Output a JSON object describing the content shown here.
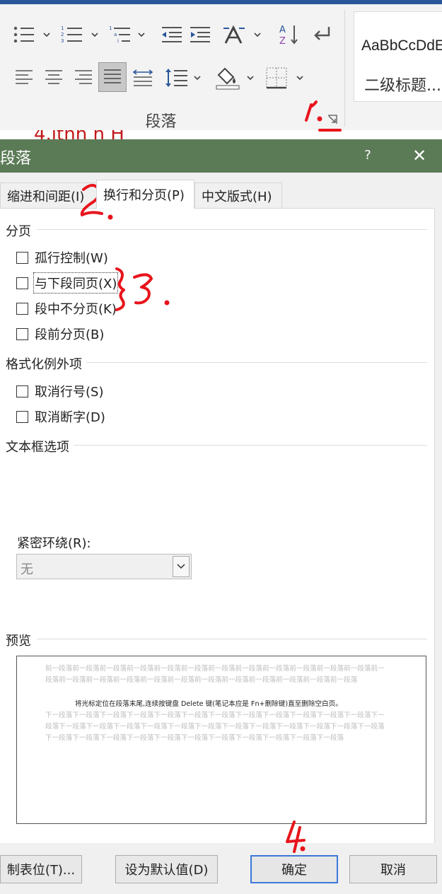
{
  "ribbon": {
    "group_label": "段落",
    "styles": [
      "AaBbCcDdE",
      "二级标题..."
    ]
  },
  "document": {
    "behind_text": "4.itnh h H"
  },
  "dialog": {
    "title": "段落",
    "help_label": "?",
    "close_label": "✕",
    "tabs": [
      "缩进和间距(I)",
      "换行和分页(P)",
      "中文版式(H)"
    ],
    "pagination": {
      "heading": "分页",
      "options": [
        {
          "label": "孤行控制(W)",
          "checked": false
        },
        {
          "label": "与下段同页(X)",
          "checked": false
        },
        {
          "label": "段中不分页(K)",
          "checked": false
        },
        {
          "label": "段前分页(B)",
          "checked": false
        }
      ]
    },
    "formatting_exceptions": {
      "heading": "格式化例外项",
      "options": [
        {
          "label": "取消行号(S)",
          "checked": false
        },
        {
          "label": "取消断字(D)",
          "checked": false
        }
      ]
    },
    "textbox": {
      "heading": "文本框选项",
      "tight_wrap_label": "紧密环绕(R):",
      "tight_wrap_value": "无"
    },
    "preview": {
      "heading": "预览",
      "before_text": "前一段落前一段落前一段落前一段落前一段落前一段落前一段落前一段落前一段落前一段落前一段落前一段落前一段落前一段落前一段落前一段落前一段落前一段落前一段落前一段落前一段落前一段落前一段落前一段落",
      "main_text": "将光标定位在段落末尾,连续按键盘 Delete 键(笔记本应是 Fn+删除键)直至删除空白页。",
      "after_text": "下一段落下一段落下一段落下一段落下一段落下一段落下一段落下一段落下一段落下一段落下一段落下一段落下一段落下一段落下一段落下一段落下一段落下一段落下一段落下一段落下一段落下一段落下一段落下一段落下一段落下一段落下一段落下一段落下一段落下一段落下一段落下一段落下一段落下一段落下一段落下一段落"
    },
    "buttons": {
      "tabs": "制表位(T)...",
      "set_default": "设为默认值(D)",
      "ok": "确定",
      "cancel": "取消"
    }
  },
  "annotations": {
    "color": "#e8141c",
    "marks": [
      "1.",
      "2.",
      "3.",
      "4."
    ]
  }
}
